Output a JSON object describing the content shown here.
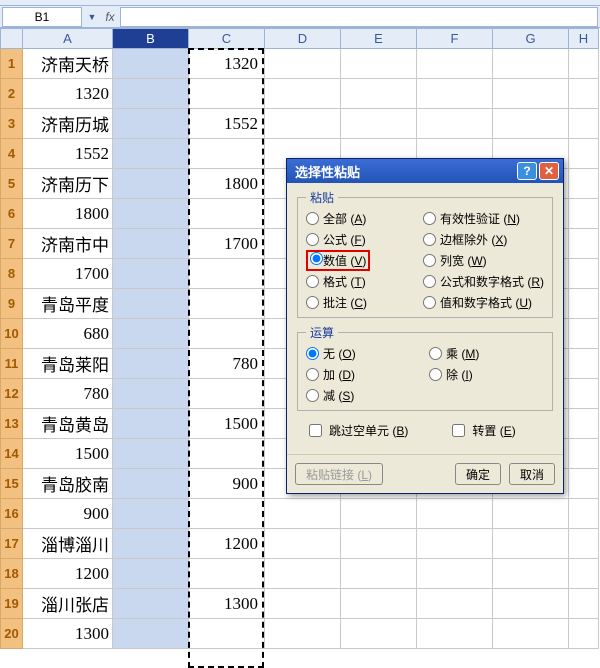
{
  "namebox": {
    "ref": "B1",
    "fx": "fx"
  },
  "columns": [
    "A",
    "B",
    "C",
    "D",
    "E",
    "F",
    "G",
    "H"
  ],
  "selected_column_index": 1,
  "rows": [
    {
      "n": 1,
      "A": "济南天桥",
      "C": "1320"
    },
    {
      "n": 2,
      "A": "1320",
      "C": ""
    },
    {
      "n": 3,
      "A": "济南历城",
      "C": "1552"
    },
    {
      "n": 4,
      "A": "1552",
      "C": ""
    },
    {
      "n": 5,
      "A": "济南历下",
      "C": "1800"
    },
    {
      "n": 6,
      "A": "1800",
      "C": ""
    },
    {
      "n": 7,
      "A": "济南市中",
      "C": "1700"
    },
    {
      "n": 8,
      "A": "1700",
      "C": ""
    },
    {
      "n": 9,
      "A": "青岛平度",
      "C": ""
    },
    {
      "n": 10,
      "A": "680",
      "C": ""
    },
    {
      "n": 11,
      "A": "青岛莱阳",
      "C": "780"
    },
    {
      "n": 12,
      "A": "780",
      "C": ""
    },
    {
      "n": 13,
      "A": "青岛黄岛",
      "C": "1500"
    },
    {
      "n": 14,
      "A": "1500",
      "C": ""
    },
    {
      "n": 15,
      "A": "青岛胶南",
      "C": "900"
    },
    {
      "n": 16,
      "A": "900",
      "C": ""
    },
    {
      "n": 17,
      "A": "淄博淄川",
      "C": "1200"
    },
    {
      "n": 18,
      "A": "1200",
      "C": ""
    },
    {
      "n": 19,
      "A": "淄川张店",
      "C": "1300"
    },
    {
      "n": 20,
      "A": "1300",
      "C": ""
    }
  ],
  "dialog": {
    "title": "选择性粘贴",
    "paste": {
      "legend": "粘贴",
      "options_left": [
        {
          "label": "全部",
          "key": "A"
        },
        {
          "label": "公式",
          "key": "F"
        },
        {
          "label": "数值",
          "key": "V",
          "selected": true,
          "marked": true
        },
        {
          "label": "格式",
          "key": "T"
        },
        {
          "label": "批注",
          "key": "C"
        }
      ],
      "options_right": [
        {
          "label": "有效性验证",
          "key": "N"
        },
        {
          "label": "边框除外",
          "key": "X"
        },
        {
          "label": "列宽",
          "key": "W"
        },
        {
          "label": "公式和数字格式",
          "key": "R"
        },
        {
          "label": "值和数字格式",
          "key": "U"
        }
      ]
    },
    "operation": {
      "legend": "运算",
      "options_left": [
        {
          "label": "无",
          "key": "O",
          "selected": true
        },
        {
          "label": "加",
          "key": "D"
        },
        {
          "label": "减",
          "key": "S"
        }
      ],
      "options_right": [
        {
          "label": "乘",
          "key": "M"
        },
        {
          "label": "除",
          "key": "I"
        }
      ]
    },
    "skip_blanks": {
      "label": "跳过空单元",
      "key": "B"
    },
    "transpose": {
      "label": "转置",
      "key": "E"
    },
    "paste_link": {
      "label": "粘贴链接",
      "key": "L"
    },
    "ok": "确定",
    "cancel": "取消"
  }
}
